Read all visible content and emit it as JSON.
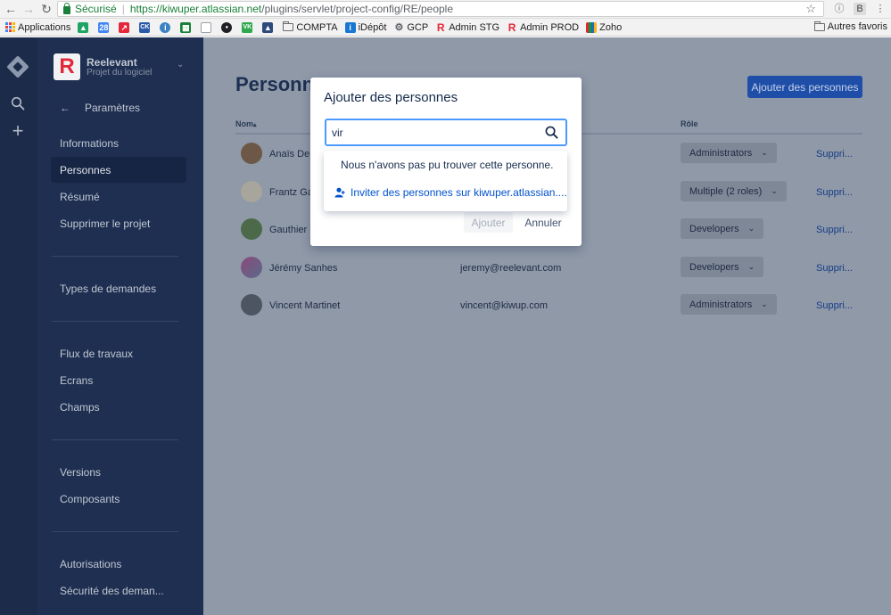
{
  "browser": {
    "secure_label": "Sécurisé",
    "url_domain": "https://kiwuper.atlassian.net",
    "url_path": "/plugins/servlet/project-config/RE/people",
    "bookmarks": [
      {
        "label": "Applications",
        "icon": "apps-icon"
      },
      {
        "label": "",
        "icon": "drive-icon",
        "color": "#1fa463"
      },
      {
        "label": "",
        "icon": "calendar-icon",
        "text": "28",
        "color": "#4285f4"
      },
      {
        "label": "",
        "icon": "arrow-icon",
        "color": "#e2283a"
      },
      {
        "label": "",
        "icon": "ck-icon",
        "color": "#2a5aa8"
      },
      {
        "label": "",
        "icon": "info-icon",
        "color": "#3b82c4"
      },
      {
        "label": "",
        "icon": "sheet-icon",
        "color": "#188038"
      },
      {
        "label": "",
        "icon": "doc-icon",
        "color": "#9aa0a6"
      },
      {
        "label": "",
        "icon": "circle-icon",
        "color": "#202124"
      },
      {
        "label": "",
        "icon": "vk-icon",
        "color": "#2fa84f"
      },
      {
        "label": "",
        "icon": "mountain-icon",
        "color": "#2d4a7a"
      },
      {
        "label": "COMPTA",
        "icon": "folder-icon"
      },
      {
        "label": "iDépôt",
        "icon": "idepot-icon",
        "text": "i",
        "color": "#1877d2"
      },
      {
        "label": "GCP",
        "icon": "gear-icon"
      },
      {
        "label": "Admin STG",
        "icon": "reelevant-icon",
        "text": "R",
        "color": "#e2283a"
      },
      {
        "label": "Admin PROD",
        "icon": "reelevant-icon",
        "text": "R",
        "color": "#e2283a"
      },
      {
        "label": "Zoho",
        "icon": "zoho-icon"
      }
    ],
    "other_favorites": "Autres favoris"
  },
  "project": {
    "name": "Reelevant",
    "type": "Projet du logiciel",
    "avatar_letter": "R"
  },
  "sidebar": {
    "back_label": "Paramètres",
    "items": [
      {
        "label": "Informations"
      },
      {
        "label": "Personnes",
        "selected": true
      },
      {
        "label": "Résumé"
      },
      {
        "label": "Supprimer le projet"
      },
      {
        "label": "Types de demandes"
      },
      {
        "label": "Flux de travaux"
      },
      {
        "label": "Ecrans"
      },
      {
        "label": "Champs"
      },
      {
        "label": "Versions"
      },
      {
        "label": "Composants"
      },
      {
        "label": "Autorisations"
      },
      {
        "label": "Sécurité des deman..."
      }
    ]
  },
  "main": {
    "title": "Personnes",
    "add_button": "Ajouter des personnes",
    "columns": {
      "name": "Nom",
      "role": "Rôle"
    },
    "rows": [
      {
        "name": "Anaïs Dem",
        "email": "",
        "role": "Administrators",
        "remove": "Suppri..."
      },
      {
        "name": "Frantz Ga",
        "email": "",
        "role": "Multiple (2 roles)",
        "remove": "Suppri..."
      },
      {
        "name": "Gauthier I",
        "email": "",
        "role": "Developers",
        "remove": "Suppri..."
      },
      {
        "name": "Jérémy Sanhes",
        "email": "jeremy@reelevant.com",
        "role": "Developers",
        "remove": "Suppri..."
      },
      {
        "name": "Vincent Martinet",
        "email": "vincent@kiwup.com",
        "role": "Administrators",
        "remove": "Suppri..."
      }
    ]
  },
  "modal": {
    "title": "Ajouter des personnes",
    "search_value": "vir",
    "no_result": "Nous n'avons pas pu trouver cette personne.",
    "invite_label": "Inviter des personnes sur kiwuper.atlassian....",
    "add_label": "Ajouter",
    "cancel_label": "Annuler"
  },
  "colors": {
    "sidebar": "#1e2f52",
    "global_nav": "#1c2b4a",
    "accent": "#0052cc",
    "focus": "#4c9aff",
    "overlay": "#8f99a8"
  }
}
